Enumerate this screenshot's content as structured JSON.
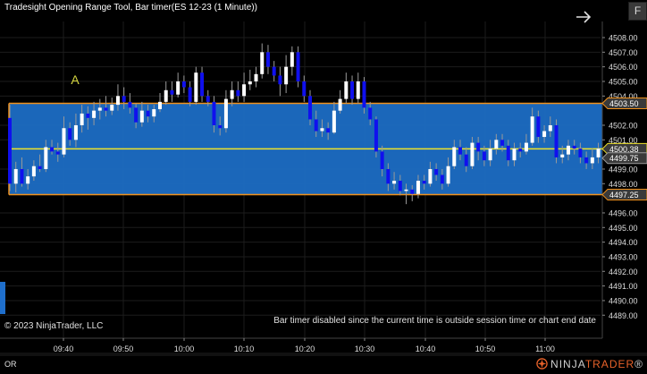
{
  "header": {
    "title": "Tradesight Opening Range Tool, Bar timer(ES 12-23 (1 Minute))"
  },
  "toolbar": {
    "f_button_label": "F",
    "arrow_icon": "right-arrow-icon"
  },
  "footer": {
    "copyright": "© 2023 NinjaTrader, LLC",
    "status_message": "Bar timer disabled since the current time is outside session time or chart end date",
    "panel_label": "OR",
    "brand_prefix": "NINJA",
    "brand_suffix": "TRADER",
    "brand_registered": "®"
  },
  "colors": {
    "background": "#000000",
    "or_box": "#1c6dc4",
    "or_border": "#f0911c",
    "mid_line": "#f0e32a",
    "candle_up": "#ffffff",
    "candle_down": "#1010ee",
    "wick": "#9a9a9a",
    "grid": "#1c1c1c",
    "label_text": "#d6d740"
  },
  "chart_data": {
    "type": "candlestick",
    "instrument": "ES 12-23 (1 Minute)",
    "x_tick_labels": [
      "09:40",
      "09:50",
      "10:00",
      "10:10",
      "10:20",
      "10:30",
      "10:40",
      "10:50",
      "11:00"
    ],
    "y_tick_labels": [
      "4508.00",
      "4507.00",
      "4506.00",
      "4505.00",
      "4504.00",
      "4502.00",
      "4501.00",
      "4499.00",
      "4498.00",
      "4496.00",
      "4495.00",
      "4494.00",
      "4493.00",
      "4492.00",
      "4491.00",
      "4490.00",
      "4489.00"
    ],
    "ylim": [
      4488.3,
      4509.0
    ],
    "grid": true,
    "opening_range": {
      "high": 4503.5,
      "low": 4497.25,
      "mid": 4500.38,
      "label": "A"
    },
    "price_labels": [
      {
        "text": "4503.50",
        "value": 4503.5,
        "style": "orange"
      },
      {
        "text": "4500.38",
        "value": 4500.38,
        "style": "yellow"
      },
      {
        "text": "4499.75",
        "value": 4499.75,
        "style": "plain"
      },
      {
        "text": "4497.25",
        "value": 4497.25,
        "style": "orange"
      }
    ],
    "candles": [
      {
        "o": 4502.5,
        "c": 4498.0,
        "h": 4503.4,
        "l": 4497.5
      },
      {
        "o": 4498.0,
        "c": 4499.0,
        "h": 4499.5,
        "l": 4497.4
      },
      {
        "o": 4499.0,
        "c": 4498.0,
        "h": 4499.8,
        "l": 4497.8
      },
      {
        "o": 4498.0,
        "c": 4498.5,
        "h": 4499.0,
        "l": 4497.6
      },
      {
        "o": 4498.5,
        "c": 4499.2,
        "h": 4499.6,
        "l": 4498.2
      },
      {
        "o": 4499.2,
        "c": 4499.0,
        "h": 4500.0,
        "l": 4498.8
      },
      {
        "o": 4499.0,
        "c": 4500.5,
        "h": 4501.0,
        "l": 4498.8
      },
      {
        "o": 4500.5,
        "c": 4500.2,
        "h": 4501.0,
        "l": 4500.0
      },
      {
        "o": 4500.2,
        "c": 4500.0,
        "h": 4500.8,
        "l": 4499.5
      },
      {
        "o": 4500.0,
        "c": 4501.8,
        "h": 4502.6,
        "l": 4499.8
      },
      {
        "o": 4501.8,
        "c": 4501.0,
        "h": 4502.2,
        "l": 4500.6
      },
      {
        "o": 4501.0,
        "c": 4502.0,
        "h": 4502.8,
        "l": 4500.5
      },
      {
        "o": 4502.0,
        "c": 4502.8,
        "h": 4503.4,
        "l": 4501.5
      },
      {
        "o": 4502.8,
        "c": 4502.5,
        "h": 4503.3,
        "l": 4501.7
      },
      {
        "o": 4502.5,
        "c": 4503.0,
        "h": 4503.6,
        "l": 4502.0
      },
      {
        "o": 4503.0,
        "c": 4503.2,
        "h": 4503.8,
        "l": 4502.4
      },
      {
        "o": 4503.2,
        "c": 4503.0,
        "h": 4504.0,
        "l": 4502.6
      },
      {
        "o": 4503.0,
        "c": 4503.4,
        "h": 4503.9,
        "l": 4502.7
      },
      {
        "o": 4503.4,
        "c": 4504.0,
        "h": 4504.8,
        "l": 4503.0
      },
      {
        "o": 4504.0,
        "c": 4503.6,
        "h": 4504.6,
        "l": 4503.1
      },
      {
        "o": 4503.6,
        "c": 4503.2,
        "h": 4504.2,
        "l": 4502.8
      },
      {
        "o": 4503.2,
        "c": 4502.2,
        "h": 4503.5,
        "l": 4501.8
      },
      {
        "o": 4502.2,
        "c": 4503.0,
        "h": 4503.6,
        "l": 4501.9
      },
      {
        "o": 4503.0,
        "c": 4502.6,
        "h": 4503.4,
        "l": 4502.2
      },
      {
        "o": 4502.6,
        "c": 4503.1,
        "h": 4503.4,
        "l": 4502.2
      },
      {
        "o": 4503.1,
        "c": 4503.6,
        "h": 4504.2,
        "l": 4502.9
      },
      {
        "o": 4503.6,
        "c": 4504.4,
        "h": 4505.0,
        "l": 4503.4
      },
      {
        "o": 4504.4,
        "c": 4504.1,
        "h": 4505.0,
        "l": 4503.6
      },
      {
        "o": 4504.1,
        "c": 4505.0,
        "h": 4505.6,
        "l": 4503.9
      },
      {
        "o": 4505.0,
        "c": 4504.6,
        "h": 4505.4,
        "l": 4504.2
      },
      {
        "o": 4504.6,
        "c": 4503.6,
        "h": 4505.0,
        "l": 4503.3
      },
      {
        "o": 4503.6,
        "c": 4505.6,
        "h": 4506.0,
        "l": 4503.4
      },
      {
        "o": 4505.6,
        "c": 4504.0,
        "h": 4506.0,
        "l": 4503.6
      },
      {
        "o": 4504.0,
        "c": 4503.6,
        "h": 4504.4,
        "l": 4503.3
      },
      {
        "o": 4503.6,
        "c": 4502.0,
        "h": 4504.0,
        "l": 4501.5
      },
      {
        "o": 4502.0,
        "c": 4501.8,
        "h": 4502.6,
        "l": 4501.3
      },
      {
        "o": 4501.8,
        "c": 4503.8,
        "h": 4504.4,
        "l": 4501.5
      },
      {
        "o": 4503.8,
        "c": 4504.4,
        "h": 4505.0,
        "l": 4503.3
      },
      {
        "o": 4504.4,
        "c": 4504.0,
        "h": 4505.0,
        "l": 4503.6
      },
      {
        "o": 4504.0,
        "c": 4504.8,
        "h": 4505.6,
        "l": 4503.6
      },
      {
        "o": 4504.8,
        "c": 4505.0,
        "h": 4505.8,
        "l": 4504.4
      },
      {
        "o": 4505.0,
        "c": 4505.5,
        "h": 4506.0,
        "l": 4504.6
      },
      {
        "o": 4505.5,
        "c": 4507.0,
        "h": 4507.6,
        "l": 4505.2
      },
      {
        "o": 4507.0,
        "c": 4506.0,
        "h": 4507.5,
        "l": 4505.5
      },
      {
        "o": 4506.0,
        "c": 4505.4,
        "h": 4506.4,
        "l": 4505.0
      },
      {
        "o": 4505.4,
        "c": 4504.8,
        "h": 4506.0,
        "l": 4504.0
      },
      {
        "o": 4504.8,
        "c": 4506.0,
        "h": 4506.8,
        "l": 4504.2
      },
      {
        "o": 4506.0,
        "c": 4507.0,
        "h": 4507.4,
        "l": 4505.4
      },
      {
        "o": 4507.0,
        "c": 4505.0,
        "h": 4507.4,
        "l": 4504.6
      },
      {
        "o": 4505.0,
        "c": 4504.0,
        "h": 4505.4,
        "l": 4503.6
      },
      {
        "o": 4504.0,
        "c": 4502.4,
        "h": 4504.4,
        "l": 4502.0
      },
      {
        "o": 4502.4,
        "c": 4501.6,
        "h": 4503.0,
        "l": 4501.2
      },
      {
        "o": 4501.6,
        "c": 4501.8,
        "h": 4502.4,
        "l": 4501.2
      },
      {
        "o": 4501.8,
        "c": 4501.5,
        "h": 4502.2,
        "l": 4501.0
      },
      {
        "o": 4501.5,
        "c": 4503.0,
        "h": 4503.6,
        "l": 4501.4
      },
      {
        "o": 4503.0,
        "c": 4503.8,
        "h": 4504.4,
        "l": 4502.8
      },
      {
        "o": 4503.8,
        "c": 4505.0,
        "h": 4505.6,
        "l": 4503.5
      },
      {
        "o": 4505.0,
        "c": 4503.8,
        "h": 4505.4,
        "l": 4503.4
      },
      {
        "o": 4503.8,
        "c": 4505.0,
        "h": 4505.6,
        "l": 4503.5
      },
      {
        "o": 4505.0,
        "c": 4503.2,
        "h": 4505.3,
        "l": 4502.8
      },
      {
        "o": 4503.2,
        "c": 4502.4,
        "h": 4503.6,
        "l": 4502.0
      },
      {
        "o": 4502.4,
        "c": 4500.2,
        "h": 4502.6,
        "l": 4499.8
      },
      {
        "o": 4500.2,
        "c": 4499.0,
        "h": 4500.6,
        "l": 4498.5
      },
      {
        "o": 4499.0,
        "c": 4498.0,
        "h": 4499.4,
        "l": 4497.5
      },
      {
        "o": 4498.0,
        "c": 4498.2,
        "h": 4498.8,
        "l": 4497.6
      },
      {
        "o": 4498.2,
        "c": 4497.5,
        "h": 4498.6,
        "l": 4497.2
      },
      {
        "o": 4497.5,
        "c": 4497.6,
        "h": 4498.0,
        "l": 4496.6
      },
      {
        "o": 4497.6,
        "c": 4497.3,
        "h": 4497.9,
        "l": 4496.8
      },
      {
        "o": 4497.3,
        "c": 4498.2,
        "h": 4498.6,
        "l": 4497.0
      },
      {
        "o": 4498.2,
        "c": 4498.0,
        "h": 4498.6,
        "l": 4497.6
      },
      {
        "o": 4498.0,
        "c": 4499.0,
        "h": 4499.5,
        "l": 4497.8
      },
      {
        "o": 4499.0,
        "c": 4498.6,
        "h": 4499.4,
        "l": 4498.2
      },
      {
        "o": 4498.6,
        "c": 4498.0,
        "h": 4499.0,
        "l": 4497.6
      },
      {
        "o": 4498.0,
        "c": 4499.2,
        "h": 4499.8,
        "l": 4497.8
      },
      {
        "o": 4499.2,
        "c": 4500.5,
        "h": 4501.0,
        "l": 4499.0
      },
      {
        "o": 4500.5,
        "c": 4500.0,
        "h": 4501.0,
        "l": 4499.6
      },
      {
        "o": 4500.0,
        "c": 4499.2,
        "h": 4500.5,
        "l": 4498.8
      },
      {
        "o": 4499.2,
        "c": 4500.8,
        "h": 4501.2,
        "l": 4499.0
      },
      {
        "o": 4500.8,
        "c": 4500.2,
        "h": 4501.2,
        "l": 4499.6
      },
      {
        "o": 4500.2,
        "c": 4499.6,
        "h": 4500.6,
        "l": 4499.2
      },
      {
        "o": 4499.6,
        "c": 4500.4,
        "h": 4501.0,
        "l": 4499.2
      },
      {
        "o": 4500.4,
        "c": 4501.0,
        "h": 4501.4,
        "l": 4500.0
      },
      {
        "o": 4501.0,
        "c": 4500.6,
        "h": 4501.4,
        "l": 4500.2
      },
      {
        "o": 4500.6,
        "c": 4499.6,
        "h": 4501.0,
        "l": 4499.2
      },
      {
        "o": 4499.6,
        "c": 4500.4,
        "h": 4500.8,
        "l": 4499.2
      },
      {
        "o": 4500.4,
        "c": 4500.2,
        "h": 4500.8,
        "l": 4499.8
      },
      {
        "o": 4500.2,
        "c": 4500.8,
        "h": 4501.4,
        "l": 4500.0
      },
      {
        "o": 4500.8,
        "c": 4502.6,
        "h": 4503.2,
        "l": 4500.6
      },
      {
        "o": 4502.6,
        "c": 4501.2,
        "h": 4503.0,
        "l": 4500.8
      },
      {
        "o": 4501.2,
        "c": 4501.6,
        "h": 4502.0,
        "l": 4500.8
      },
      {
        "o": 4501.6,
        "c": 4502.0,
        "h": 4502.6,
        "l": 4501.2
      },
      {
        "o": 4502.0,
        "c": 4499.8,
        "h": 4502.4,
        "l": 4499.4
      },
      {
        "o": 4499.8,
        "c": 4500.0,
        "h": 4500.6,
        "l": 4499.4
      },
      {
        "o": 4500.0,
        "c": 4500.6,
        "h": 4501.0,
        "l": 4499.6
      },
      {
        "o": 4500.6,
        "c": 4500.4,
        "h": 4501.0,
        "l": 4500.0
      },
      {
        "o": 4500.4,
        "c": 4499.8,
        "h": 4500.8,
        "l": 4499.4
      },
      {
        "o": 4499.8,
        "c": 4499.4,
        "h": 4500.2,
        "l": 4499.0
      },
      {
        "o": 4499.4,
        "c": 4499.8,
        "h": 4500.4,
        "l": 4499.0
      },
      {
        "o": 4499.8,
        "c": 4500.4,
        "h": 4500.8,
        "l": 4499.4
      },
      {
        "o": 4500.4,
        "c": 4499.6,
        "h": 4500.8,
        "l": 4499.2
      },
      {
        "o": 4499.6,
        "c": 4500.8,
        "h": 4501.4,
        "l": 4499.4
      },
      {
        "o": 4500.8,
        "c": 4501.6,
        "h": 4502.2,
        "l": 4500.6
      },
      {
        "o": 4501.6,
        "c": 4499.8,
        "h": 4502.0,
        "l": 4499.4
      },
      {
        "o": 4499.8,
        "c": 4500.0,
        "h": 4500.6,
        "l": 4499.4
      },
      {
        "o": 4500.0,
        "c": 4500.8,
        "h": 4501.2,
        "l": 4499.6
      },
      {
        "o": 4500.8,
        "c": 4500.2,
        "h": 4501.2,
        "l": 4499.8
      },
      {
        "o": 4500.2,
        "c": 4499.2,
        "h": 4500.6,
        "l": 4498.8
      },
      {
        "o": 4499.2,
        "c": 4498.8,
        "h": 4499.6,
        "l": 4498.4
      },
      {
        "o": 4498.8,
        "c": 4499.2,
        "h": 4499.8,
        "l": 4498.4
      },
      {
        "o": 4499.2,
        "c": 4498.6,
        "h": 4499.6,
        "l": 4498.2
      },
      {
        "o": 4498.6,
        "c": 4499.2,
        "h": 4499.6,
        "l": 4498.2
      },
      {
        "o": 4499.2,
        "c": 4499.6,
        "h": 4500.2,
        "l": 4498.8
      },
      {
        "o": 4499.6,
        "c": 4499.0,
        "h": 4500.0,
        "l": 4498.6
      },
      {
        "o": 4499.0,
        "c": 4500.2,
        "h": 4500.8,
        "l": 4498.8
      },
      {
        "o": 4500.2,
        "c": 4501.0,
        "h": 4501.6,
        "l": 4499.8
      },
      {
        "o": 4501.0,
        "c": 4499.2,
        "h": 4501.4,
        "l": 4498.8
      },
      {
        "o": 4499.2,
        "c": 4499.6,
        "h": 4500.2,
        "l": 4498.8
      },
      {
        "o": 4499.6,
        "c": 4502.0,
        "h": 4502.4,
        "l": 4499.4
      },
      {
        "o": 4502.0,
        "c": 4500.4,
        "h": 4502.4,
        "l": 4500.0
      },
      {
        "o": 4500.4,
        "c": 4499.2,
        "h": 4500.8,
        "l": 4498.8
      },
      {
        "o": 4499.2,
        "c": 4498.2,
        "h": 4499.6,
        "l": 4497.6
      },
      {
        "o": 4498.2,
        "c": 4499.4,
        "h": 4499.8,
        "l": 4497.8
      },
      {
        "o": 4499.4,
        "c": 4498.8,
        "h": 4499.8,
        "l": 4498.4
      },
      {
        "o": 4498.8,
        "c": 4499.6,
        "h": 4500.2,
        "l": 4498.4
      },
      {
        "o": 4499.6,
        "c": 4499.0,
        "h": 4500.0,
        "l": 4498.6
      },
      {
        "o": 4499.0,
        "c": 4500.6,
        "h": 4501.0,
        "l": 4498.8
      },
      {
        "o": 4500.6,
        "c": 4498.6,
        "h": 4501.0,
        "l": 4498.2
      },
      {
        "o": 4498.6,
        "c": 4499.0,
        "h": 4499.4,
        "l": 4498.2
      },
      {
        "o": 4499.0,
        "c": 4498.2,
        "h": 4499.4,
        "l": 4497.8
      },
      {
        "o": 4498.2,
        "c": 4497.6,
        "h": 4498.6,
        "l": 4497.2
      },
      {
        "o": 4497.6,
        "c": 4497.8,
        "h": 4498.2,
        "l": 4497.2
      },
      {
        "o": 4497.8,
        "c": 4497.2,
        "h": 4498.2,
        "l": 4496.8
      },
      {
        "o": 4497.2,
        "c": 4498.4,
        "h": 4498.8,
        "l": 4497.0
      },
      {
        "o": 4498.4,
        "c": 4499.2,
        "h": 4499.6,
        "l": 4498.0
      }
    ]
  }
}
